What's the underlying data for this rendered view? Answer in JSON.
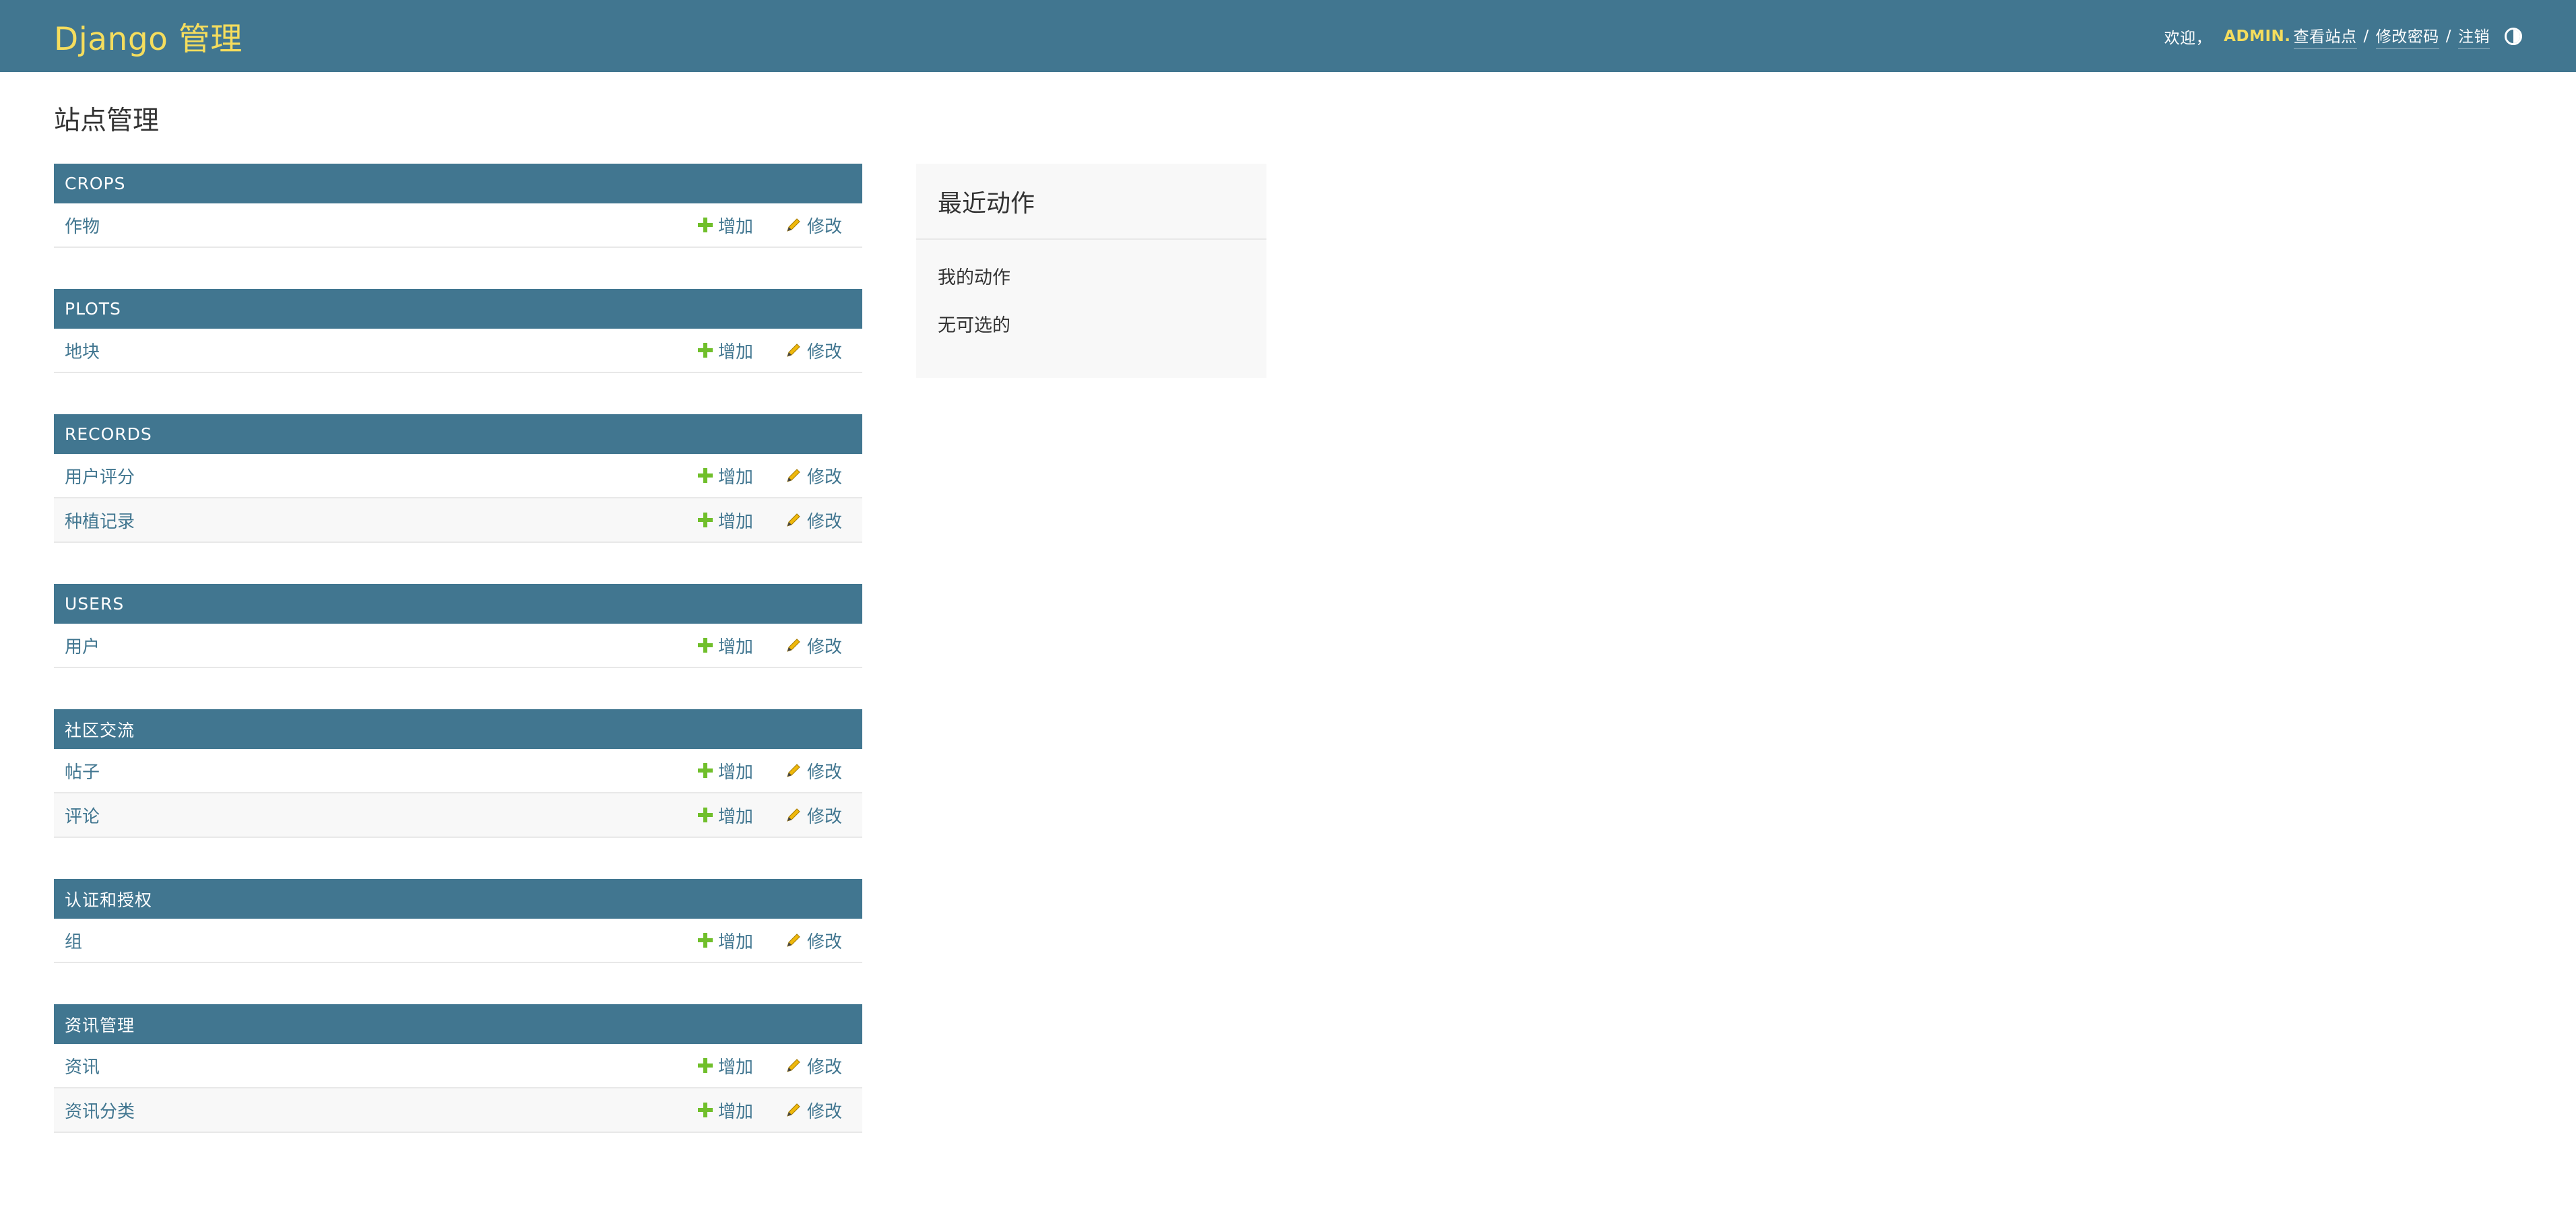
{
  "header": {
    "branding": "Django 管理",
    "welcome": "欢迎，",
    "username": "ADMIN.",
    "view_site": "查看站点",
    "change_password": "修改密码",
    "logout": "注销",
    "separator": "/"
  },
  "page_title": "站点管理",
  "action_labels": {
    "add": "增加",
    "change": "修改"
  },
  "modules": [
    {
      "caption": "CROPS",
      "models": [
        "作物"
      ]
    },
    {
      "caption": "PLOTS",
      "models": [
        "地块"
      ]
    },
    {
      "caption": "RECORDS",
      "models": [
        "用户评分",
        "种植记录"
      ]
    },
    {
      "caption": "USERS",
      "models": [
        "用户"
      ]
    },
    {
      "caption": "社区交流",
      "models": [
        "帖子",
        "评论"
      ]
    },
    {
      "caption": "认证和授权",
      "models": [
        "组"
      ]
    },
    {
      "caption": "资讯管理",
      "models": [
        "资讯",
        "资讯分类"
      ]
    }
  ],
  "recent_actions": {
    "title": "最近动作",
    "my_actions": "我的动作",
    "empty": "无可选的"
  },
  "colors": {
    "header_bg": "#417690",
    "branding": "#f5dd5d",
    "link": "#417690",
    "add_icon": "#70bf2b",
    "change_icon": "#efb80b"
  }
}
